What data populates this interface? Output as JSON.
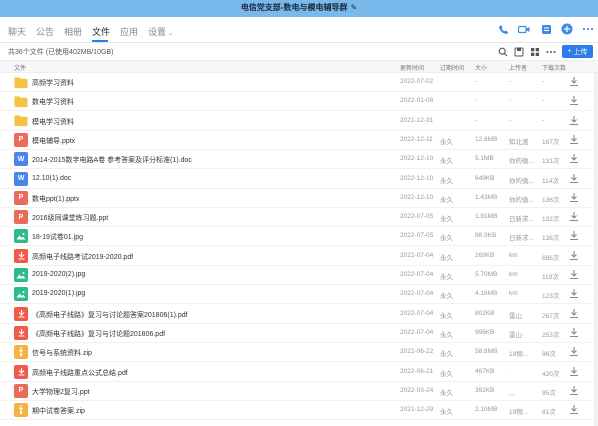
{
  "window": {
    "title": "电信党支部-数电与模电辅导群",
    "edit_icon": "✎"
  },
  "tabs": [
    {
      "label": "聊天",
      "active": false
    },
    {
      "label": "公告",
      "active": false
    },
    {
      "label": "相册",
      "active": false
    },
    {
      "label": "文件",
      "active": true
    },
    {
      "label": "应用",
      "active": false
    },
    {
      "label": "设置",
      "active": false,
      "chevron": "⌄"
    }
  ],
  "nav_icons": [
    "phone-icon",
    "video-icon",
    "whiteboard-icon",
    "add-member-icon",
    "more-icon"
  ],
  "toolbar": {
    "file_count": "共36个文件 (已使用402MB/10GB)",
    "upload_label": "上传",
    "upload_plus": "+"
  },
  "columns": {
    "file": "文件",
    "updated": "更新时间",
    "expires": "过期时间",
    "size": "大小",
    "uploader": "上传者",
    "downloads": "下载次数"
  },
  "files": [
    {
      "type": "folder",
      "name": "高频学习资料",
      "updated": "2022-07-02",
      "expires": "",
      "size": "-",
      "uploader": "-",
      "downloads": "-"
    },
    {
      "type": "folder",
      "name": "数电学习资料",
      "updated": "2022-01-08",
      "expires": "",
      "size": "-",
      "uploader": "-",
      "downloads": "-"
    },
    {
      "type": "folder",
      "name": "模电学习资料",
      "updated": "2021-12-31",
      "expires": "",
      "size": "-",
      "uploader": "-",
      "downloads": "-"
    },
    {
      "type": "ppt",
      "name": "模电辅导.pptx",
      "updated": "2022-12-11",
      "expires": "永久",
      "size": "12.6MB",
      "uploader": "知北渡",
      "downloads": "167次"
    },
    {
      "type": "doc",
      "name": "2014-2015数字电路A卷 参考答案及评分标准(1).doc",
      "updated": "2022-12-10",
      "expires": "永久",
      "size": "5.1MB",
      "uploader": "你的微...",
      "downloads": "131次"
    },
    {
      "type": "doc",
      "name": "12.10(1).doc",
      "updated": "2022-12-10",
      "expires": "永久",
      "size": "649KB",
      "uploader": "你的微...",
      "downloads": "114次"
    },
    {
      "type": "ppt",
      "name": "数电ppt(1).pptx",
      "updated": "2022-12-10",
      "expires": "永久",
      "size": "1.43MB",
      "uploader": "你的微...",
      "downloads": "136次"
    },
    {
      "type": "ppt",
      "name": "2016级同课堂练习题.ppt",
      "updated": "2022-07-05",
      "expires": "永久",
      "size": "1.81MB",
      "uploader": "日新求...",
      "downloads": "132次"
    },
    {
      "type": "img",
      "name": "18-19试卷01.jpg",
      "updated": "2022-07-05",
      "expires": "永久",
      "size": "88.9KB",
      "uploader": "日新求...",
      "downloads": "136次"
    },
    {
      "type": "pdf",
      "name": "高频电子线路考试2019-2020.pdf",
      "updated": "2022-07-04",
      "expires": "永久",
      "size": "269KB",
      "uploader": "km",
      "downloads": "686次"
    },
    {
      "type": "img",
      "name": "2019-2020(2).jpg",
      "updated": "2022-07-04",
      "expires": "永久",
      "size": "5.70MB",
      "uploader": "km",
      "downloads": "119次"
    },
    {
      "type": "img",
      "name": "2019-2020(1).jpg",
      "updated": "2022-07-04",
      "expires": "永久",
      "size": "4.16MB",
      "uploader": "km",
      "downloads": "123次"
    },
    {
      "type": "pdf",
      "name": "《高频电子线路》复习与讨论题答案201806(1).pdf",
      "updated": "2022-07-04",
      "expires": "永久",
      "size": "802KB",
      "uploader": "雷山",
      "downloads": "267次"
    },
    {
      "type": "pdf",
      "name": "《高频电子线路》复习与讨论题201806.pdf",
      "updated": "2022-07-04",
      "expires": "永久",
      "size": "996KB",
      "uploader": "雷山",
      "downloads": "253次"
    },
    {
      "type": "zip",
      "name": "信号与系统资料.zip",
      "updated": "2022-06-22",
      "expires": "永久",
      "size": "58.8MB",
      "uploader": "19物...",
      "downloads": "96次"
    },
    {
      "type": "pdf",
      "name": "高频电子线路重点公式总结.pdf",
      "updated": "2022-06-21",
      "expires": "永久",
      "size": "467KB",
      "uploader": ".",
      "downloads": "420次"
    },
    {
      "type": "ppt",
      "name": "大学物理2复习.ppt",
      "updated": "2022-03-24",
      "expires": "永久",
      "size": "392KB",
      "uploader": "、、",
      "downloads": "95次"
    },
    {
      "type": "zip",
      "name": "期中试卷答案.zip",
      "updated": "2021-12-29",
      "expires": "永久",
      "size": "2.10MB",
      "uploader": "19物...",
      "downloads": "81次"
    }
  ],
  "icon_letters": {
    "ppt": "P",
    "doc": "W",
    "pdf": "",
    "img": "",
    "zip": ""
  },
  "colors": {
    "accent": "#2b7de9",
    "titlebar": "#78b8ea"
  }
}
